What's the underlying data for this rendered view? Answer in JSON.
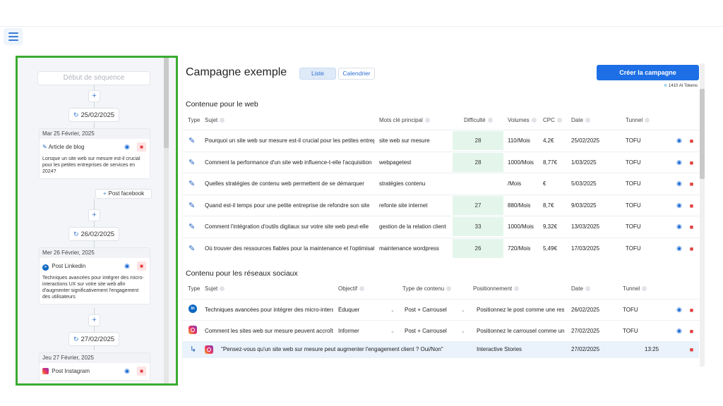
{
  "nav": {
    "menu_icon": "hamburger-icon"
  },
  "sidebar": {
    "start_placeholder": "Début de séquence",
    "plus": "+",
    "dates": [
      "25/02/2025",
      "26/02/2025",
      "27/02/2025"
    ],
    "cards": [
      {
        "day": "Mar 25 Février, 2025",
        "type": "Article de blog",
        "icon": "pen-icon",
        "text": "Lorsque un site web sur mesure est-il crucial pour les petites entreprises de services en 2024?"
      },
      {
        "day": "Mer 26 Février, 2025",
        "type": "Post Linkedin",
        "icon": "linkedin-icon",
        "text": "Techniques avancées pour intégrer des micro-interactions UX sur votre site web afin d'augmenter significativement l'engagement des utilisateurs"
      },
      {
        "day": "Jeu 27 Février, 2025",
        "type": "Post Instagram",
        "icon": "instagram-icon",
        "text": ""
      }
    ],
    "post_facebook": "Post facebook"
  },
  "main": {
    "title": "Campagne exemple",
    "tabs": [
      {
        "label": "Liste"
      },
      {
        "label": "Calendrier"
      }
    ],
    "create_button": "Créer la campagne",
    "tokens": "1410 AI Tokens",
    "web": {
      "title": "Contenue pour le web",
      "headers": [
        "Type",
        "Sujet",
        "Mots clé principal",
        "Difficulté",
        "Volumes",
        "CPC",
        "Date",
        "Tunnel"
      ],
      "rows": [
        {
          "subject": "Pourquoi un site web sur mesure est-il crucial pour les petites entreprises",
          "keyword": "site web sur mesure",
          "difficulty": "28",
          "volume": "110/Mois",
          "cpc": "4,2€",
          "date": "25/02/2025",
          "tunnel": "TOFU"
        },
        {
          "subject": "Comment la performance d'un site web influence-t-elle l'acquisition",
          "keyword": "webpagetest",
          "difficulty": "28",
          "volume": "1000/Mois",
          "cpc": "8,77€",
          "date": "1/03/2025",
          "tunnel": "TOFU"
        },
        {
          "subject": "Quelles stratégies de contenu web permettent de se démarquer",
          "keyword": "stratégies contenu",
          "difficulty": "",
          "volume": "/Mois",
          "cpc": "€",
          "date": "5/03/2025",
          "tunnel": "TOFU"
        },
        {
          "subject": "Quand est-il temps pour une petite entreprise de refondre son site",
          "keyword": "refonte site internet",
          "difficulty": "27",
          "volume": "880/Mois",
          "cpc": "8,7€",
          "date": "9/03/2025",
          "tunnel": "TOFU"
        },
        {
          "subject": "Comment l'intégration d'outils digitaux sur votre site web peut-elle",
          "keyword": "gestion de la relation client",
          "difficulty": "33",
          "volume": "1000/Mois",
          "cpc": "9,32€",
          "date": "13/03/2025",
          "tunnel": "TOFU"
        },
        {
          "subject": "Où trouver des ressources fiables pour la maintenance et l'optimisation",
          "keyword": "maintenance wordpress",
          "difficulty": "26",
          "volume": "720/Mois",
          "cpc": "5,49€",
          "date": "17/03/2025",
          "tunnel": "TOFU"
        }
      ]
    },
    "social": {
      "title": "Contenu pour les réseaux sociaux",
      "headers": [
        "Type",
        "Sujet",
        "Objectif",
        "Type de contenu",
        "Positionnement",
        "Date",
        "Tunnel"
      ],
      "rows": [
        {
          "icon": "linkedin-icon",
          "subject": "Techniques avancées pour intégrer des micro-interactions",
          "objective": "Éduquer",
          "content_type": "Post + Carrousel",
          "positioning": "Positionnez le post comme une ressource",
          "date": "26/02/2025",
          "tunnel": "TOFU"
        },
        {
          "icon": "instagram-icon",
          "subject": "Comment les sites web sur mesure peuvent accroître",
          "objective": "Informer",
          "content_type": "Post + Carrousel",
          "positioning": "Positionnez le carrousel comme une",
          "date": "27/02/2025",
          "tunnel": "TOFU"
        }
      ],
      "sub_row": {
        "text": "\"Pensez-vous qu'un site web sur mesure peut augmenter l'engagement client ? Oui/Non\"",
        "positioning": "Interactive Stories",
        "date": "27/02/2025",
        "time": "13:25"
      }
    }
  }
}
